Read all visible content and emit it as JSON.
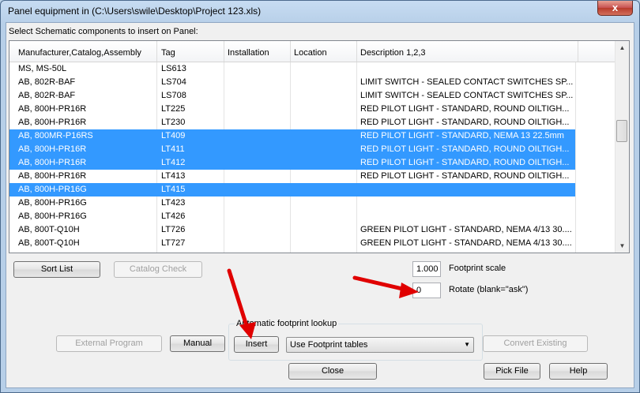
{
  "window": {
    "title": "Panel equipment in (C:\\Users\\swile\\Desktop\\Project 123.xls)",
    "close_glyph": "x"
  },
  "instruction": "Select Schematic components to insert on Panel:",
  "table": {
    "columns": [
      "Manufacturer,Catalog,Assembly",
      "Tag",
      "Installation",
      "Location",
      "Description 1,2,3"
    ],
    "rows": [
      {
        "mfr": "MS, MS-50L",
        "tag": "LS613",
        "inst": "",
        "loc": "",
        "desc": "",
        "selected": false
      },
      {
        "mfr": "AB, 802R-BAF",
        "tag": "LS704",
        "inst": "",
        "loc": "",
        "desc": "LIMIT SWITCH - SEALED CONTACT SWITCHES SP...",
        "selected": false
      },
      {
        "mfr": "AB, 802R-BAF",
        "tag": "LS708",
        "inst": "",
        "loc": "",
        "desc": "LIMIT SWITCH - SEALED CONTACT SWITCHES SP...",
        "selected": false
      },
      {
        "mfr": "AB, 800H-PR16R",
        "tag": "LT225",
        "inst": "",
        "loc": "",
        "desc": "RED PILOT LIGHT - STANDARD, ROUND OILTIGH...",
        "selected": false
      },
      {
        "mfr": "AB, 800H-PR16R",
        "tag": "LT230",
        "inst": "",
        "loc": "",
        "desc": "RED PILOT LIGHT - STANDARD, ROUND OILTIGH...",
        "selected": false
      },
      {
        "mfr": "AB, 800MR-P16RS",
        "tag": "LT409",
        "inst": "",
        "loc": "",
        "desc": "RED PILOT LIGHT - STANDARD, NEMA 13 22.5mm",
        "selected": true
      },
      {
        "mfr": "AB, 800H-PR16R",
        "tag": "LT411",
        "inst": "",
        "loc": "",
        "desc": "RED PILOT LIGHT - STANDARD, ROUND OILTIGH...",
        "selected": true
      },
      {
        "mfr": "AB, 800H-PR16R",
        "tag": "LT412",
        "inst": "",
        "loc": "",
        "desc": "RED PILOT LIGHT - STANDARD, ROUND OILTIGH...",
        "selected": true
      },
      {
        "mfr": "AB, 800H-PR16R",
        "tag": "LT413",
        "inst": "",
        "loc": "",
        "desc": "RED PILOT LIGHT - STANDARD, ROUND OILTIGH...",
        "selected": false
      },
      {
        "mfr": "AB, 800H-PR16G",
        "tag": "LT415",
        "inst": "",
        "loc": "",
        "desc": "",
        "selected": true
      },
      {
        "mfr": "AB, 800H-PR16G",
        "tag": "LT423",
        "inst": "",
        "loc": "",
        "desc": "",
        "selected": false
      },
      {
        "mfr": "AB, 800H-PR16G",
        "tag": "LT426",
        "inst": "",
        "loc": "",
        "desc": "",
        "selected": false
      },
      {
        "mfr": "AB, 800T-Q10H",
        "tag": "LT726",
        "inst": "",
        "loc": "",
        "desc": "GREEN PILOT LIGHT - STANDARD, NEMA 4/13 30....",
        "selected": false
      },
      {
        "mfr": "AB, 800T-Q10H",
        "tag": "LT727",
        "inst": "",
        "loc": "",
        "desc": "GREEN PILOT LIGHT - STANDARD, NEMA 4/13 30....",
        "selected": false
      }
    ]
  },
  "buttons": {
    "sort_list": "Sort List",
    "catalog_check": "Catalog Check",
    "external_program": "External Program",
    "manual": "Manual",
    "insert": "Insert",
    "convert_existing": "Convert Existing",
    "close": "Close",
    "pick_file": "Pick File",
    "help": "Help"
  },
  "footprint": {
    "scale_value": "1.000",
    "scale_label": "Footprint scale",
    "rotate_value": "0",
    "rotate_label": "Rotate (blank=\"ask\")"
  },
  "auto_lookup": {
    "group_label": "Automatic footprint lookup",
    "selected_option": "Use Footprint tables"
  },
  "colors": {
    "selection": "#3399ff",
    "annotation_arrow": "#e00000"
  }
}
